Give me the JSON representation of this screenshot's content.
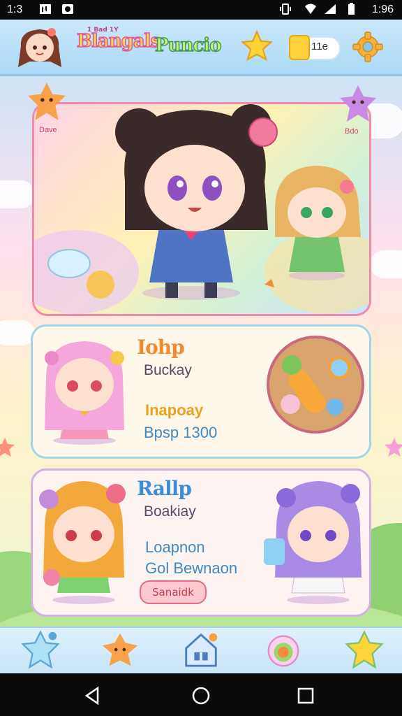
{
  "status_bar": {
    "time_left": "1:3",
    "time_right": "1:96"
  },
  "header": {
    "logo_small_text": "1 Bad 1Y",
    "logo_text_1": "Blangals",
    "logo_text_2": "Puncio",
    "coin_count": "11e"
  },
  "hero": {
    "badge_left": "Dave",
    "badge_right": "Bdo"
  },
  "cards": [
    {
      "title": "Iohp",
      "subtitle": "Buckay",
      "line1": "Inapoay",
      "line2": "Bpsp 1300",
      "title_color": "#f08a2c"
    },
    {
      "title": "Rallp",
      "subtitle": "Boakiay",
      "line1": "Loapnon",
      "line2": "Gol Bewnaon",
      "chip": "Sanaidk",
      "title_color": "#3a8fd8"
    }
  ],
  "colors": {
    "accent_pink": "#f08bab",
    "accent_blue": "#9dd6ea",
    "accent_purple": "#d2b0e4"
  },
  "icons": {
    "top": [
      "avatar-girl-icon",
      "star-icon",
      "coin-icon",
      "gear-icon"
    ],
    "bottom_nav": [
      "star-icon",
      "pet-icon",
      "home-icon",
      "candy-icon",
      "star-icon"
    ],
    "system": [
      "back-icon",
      "home-circle-icon",
      "recents-icon"
    ]
  }
}
